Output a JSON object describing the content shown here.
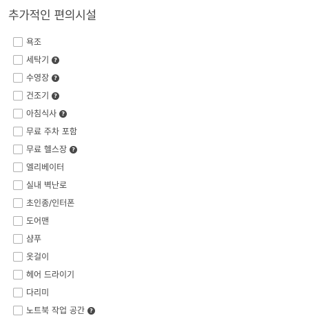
{
  "section": {
    "title": "추가적인 편의시설"
  },
  "amenities": [
    {
      "label": "욕조",
      "help": false
    },
    {
      "label": "세탁기",
      "help": true
    },
    {
      "label": "수영장",
      "help": true
    },
    {
      "label": "건조기",
      "help": true
    },
    {
      "label": "아침식사",
      "help": true
    },
    {
      "label": "무료 주차 포함",
      "help": false
    },
    {
      "label": "무료 헬스장",
      "help": true
    },
    {
      "label": "엘리베이터",
      "help": false
    },
    {
      "label": "실내 벽난로",
      "help": false
    },
    {
      "label": "초인종/인터폰",
      "help": false
    },
    {
      "label": "도어맨",
      "help": false
    },
    {
      "label": "샴푸",
      "help": false
    },
    {
      "label": "옷걸이",
      "help": false
    },
    {
      "label": "헤어 드라이기",
      "help": false
    },
    {
      "label": "다리미",
      "help": false
    },
    {
      "label": "노트북 작업 공간",
      "help": true
    }
  ],
  "icons": {
    "help_glyph": "?",
    "help_icon_name": "question-circle-icon"
  },
  "colors": {
    "text": "#484848",
    "checkbox_border": "#b0b0b0",
    "help_icon_bg": "#484848"
  }
}
